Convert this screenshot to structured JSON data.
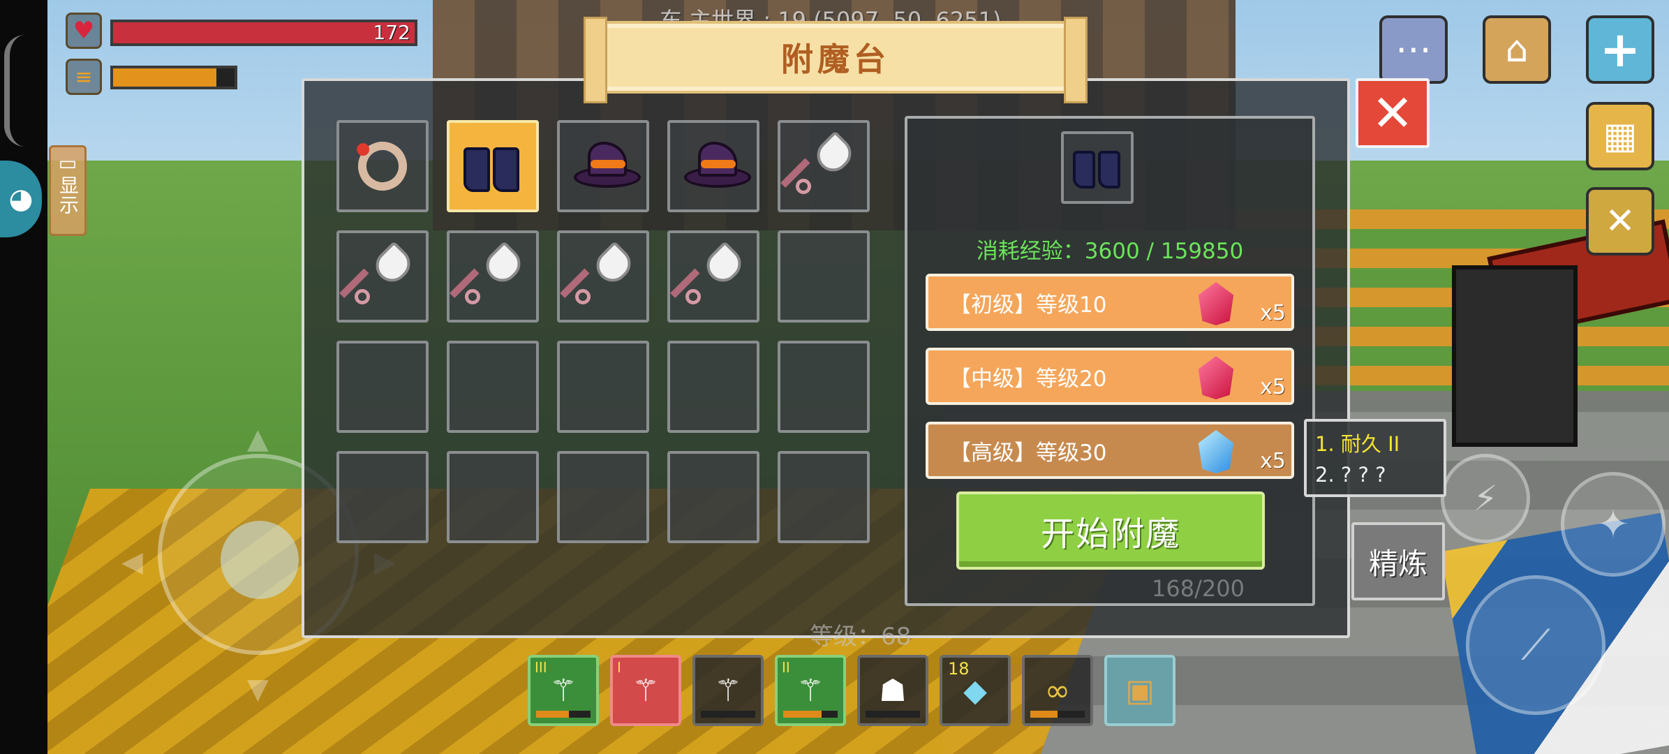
{
  "hud": {
    "hp_value": "172",
    "hp_fraction": 1.0,
    "hunger_fraction": 0.85,
    "show_label": "显示",
    "coords": "东  主世界 : 19 (5097, 50, 6251)"
  },
  "panel": {
    "title": "附魔台",
    "close_icon": "✕",
    "inventory_items": [
      "ring",
      "boots",
      "wizard-hat",
      "wizard-hat",
      "shovel",
      "shovel",
      "shovel",
      "shovel",
      "shovel",
      "",
      "",
      "",
      "",
      "",
      "",
      "",
      "",
      "",
      "",
      ""
    ],
    "selected_index": 1,
    "target_item": "boots",
    "xp_cost": "消耗经验：3600 / 159850",
    "tiers": [
      {
        "label": "【初级】等级10",
        "gem": "red-crystal",
        "count": "x5"
      },
      {
        "label": "【中级】等级20",
        "gem": "red-crystal",
        "count": "x5"
      },
      {
        "label": "【高级】等级30",
        "gem": "blue-crystal",
        "count": "x5"
      }
    ],
    "start_button": "开始附魔",
    "tooltip": {
      "line1": "1. 耐久 II",
      "line2": "2. ? ? ?"
    },
    "refine_button": "精炼",
    "background_level": "等级：68",
    "background_count": "168/200"
  },
  "hotbar": [
    {
      "kind": "staff",
      "style": "green",
      "badge": "III",
      "durability": 0.6
    },
    {
      "kind": "staff",
      "style": "red",
      "badge": "I",
      "durability": 0.0
    },
    {
      "kind": "staff",
      "style": "dark",
      "badge": "",
      "durability": 0.0
    },
    {
      "kind": "staff",
      "style": "green",
      "badge": "II",
      "durability": 0.7
    },
    {
      "kind": "cape",
      "style": "dark",
      "badge": "",
      "durability": 0.0
    },
    {
      "kind": "diamond",
      "style": "dark",
      "badge": "18",
      "durability": 0.0
    },
    {
      "kind": "goggles",
      "style": "dark",
      "badge": "",
      "durability": 0.5
    },
    {
      "kind": "backpack",
      "style": "bag",
      "badge": "",
      "durability": 0.0
    }
  ],
  "colors": {
    "hp": "#c8303e",
    "hunger": "#e3921c",
    "xp_text": "#6be45a",
    "start_button": "#8fcf44",
    "close_button": "#e44838",
    "title_text": "#b05e22"
  }
}
